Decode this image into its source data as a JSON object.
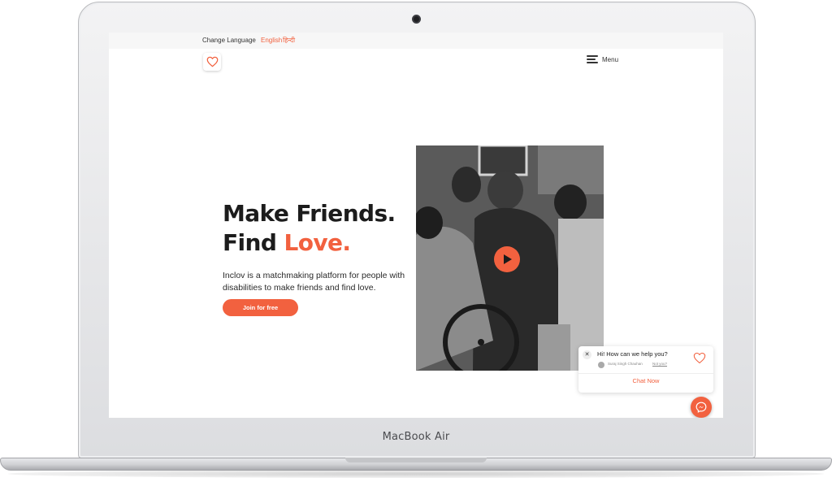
{
  "device": {
    "brand_label": "MacBook Air"
  },
  "header": {
    "change_language_label": "Change Language",
    "lang_english": "English",
    "lang_hindi": "हिन्दी",
    "logo_icon": "heart-outline-icon",
    "menu_label": "Menu",
    "menu_icon": "hamburger-icon"
  },
  "hero": {
    "headline_line1": "Make Friends.",
    "headline_line2_prefix": "Find ",
    "headline_line2_accent": "Love.",
    "tagline": "Inclov is a matchmaking platform for people with disabilities to make friends and find love.",
    "cta_label": "Join for free",
    "video_icon": "play-icon"
  },
  "chat_widget": {
    "greeting": "Hi! How can we help you?",
    "agent_name": "Suraj Singh Chauhan",
    "agent_link": "Not you?",
    "cta_label": "Chat Now",
    "close_icon": "close-icon",
    "heart_icon": "heart-outline-icon",
    "messenger_icon": "messenger-icon"
  },
  "colors": {
    "accent": "#f2613f",
    "text": "#1c1c1c"
  }
}
